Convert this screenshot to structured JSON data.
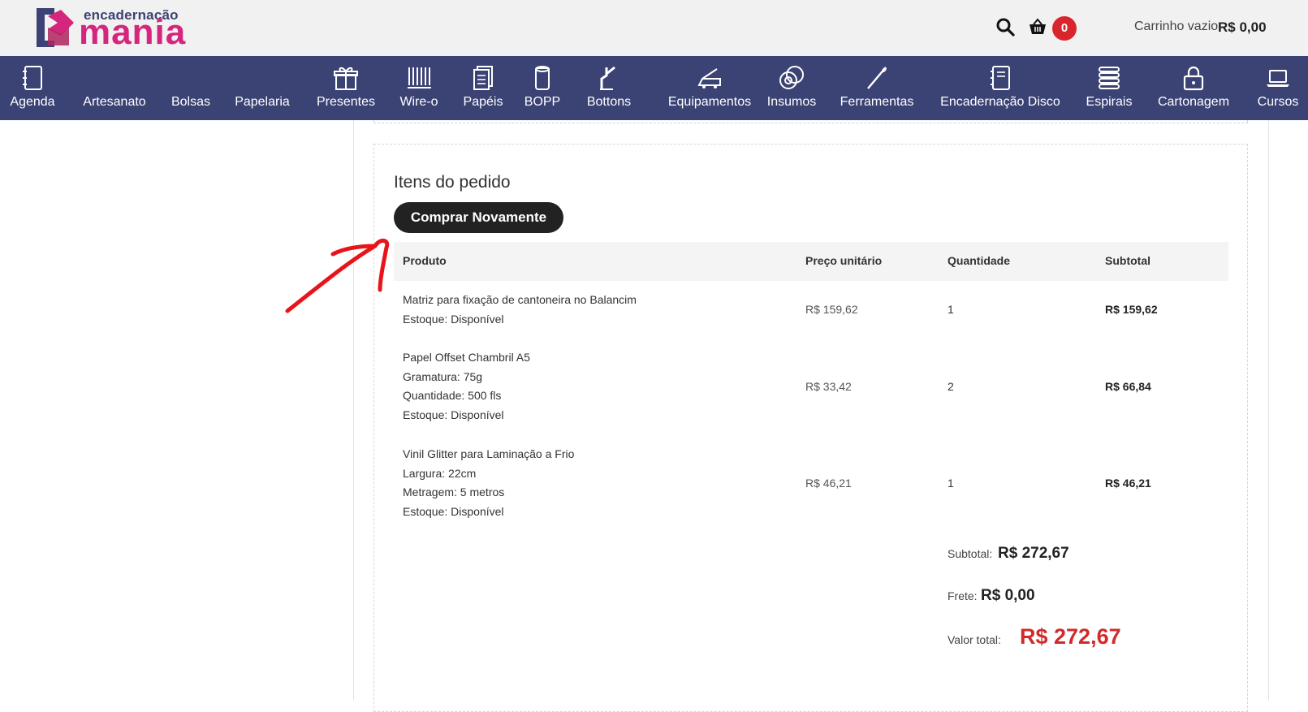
{
  "header": {
    "logo_small": "encadernação",
    "logo_big": "mania",
    "cart_count": "0",
    "cart_status": "Carrinho vazio",
    "cart_total": "R$ 0,00"
  },
  "nav": [
    {
      "label": "Agenda",
      "icon": "notebook-icon"
    },
    {
      "label": "Artesanato",
      "icon": "craft-icon"
    },
    {
      "label": "Bolsas",
      "icon": "bag-icon"
    },
    {
      "label": "Papelaria",
      "icon": "stationery-icon"
    },
    {
      "label": "Presentes",
      "icon": "gift-icon"
    },
    {
      "label": "Wire-o",
      "icon": "wire-o-icon"
    },
    {
      "label": "Papéis",
      "icon": "papers-icon"
    },
    {
      "label": "BOPP",
      "icon": "bopp-roll-icon"
    },
    {
      "label": "Bottons",
      "icon": "button-press-icon"
    },
    {
      "label": "Equipamentos",
      "icon": "laminator-icon"
    },
    {
      "label": "Insumos",
      "icon": "tape-rolls-icon"
    },
    {
      "label": "Ferramentas",
      "icon": "needle-icon"
    },
    {
      "label": "Encadernação Disco",
      "icon": "disc-binding-icon"
    },
    {
      "label": "Espirais",
      "icon": "spiral-icon"
    },
    {
      "label": "Cartonagem",
      "icon": "lock-box-icon"
    },
    {
      "label": "Cursos",
      "icon": "laptop-icon"
    }
  ],
  "order": {
    "title": "Itens do pedido",
    "buy_again": "Comprar Novamente",
    "columns": [
      "Produto",
      "Preço unitário",
      "Quantidade",
      "Subtotal"
    ],
    "items": [
      {
        "lines": [
          "Matriz para fixação de cantoneira no Balancim",
          "Estoque: Disponível"
        ],
        "price": "R$ 159,62",
        "qty": "1",
        "subtotal": "R$ 159,62"
      },
      {
        "lines": [
          "Papel Offset Chambril A5",
          "Gramatura: 75g",
          "Quantidade: 500 fls",
          "Estoque: Disponível"
        ],
        "price": "R$ 33,42",
        "qty": "2",
        "subtotal": "R$ 66,84"
      },
      {
        "lines": [
          "Vinil Glitter para Laminação a Frio",
          "Largura: 22cm",
          "Metragem: 5 metros",
          "Estoque: Disponível"
        ],
        "price": "R$ 46,21",
        "qty": "1",
        "subtotal": "R$ 46,21"
      }
    ],
    "totals": {
      "subtotal_label": "Subtotal:",
      "subtotal_value": "R$ 272,67",
      "frete_label": "Frete:",
      "frete_value": "R$ 0,00",
      "total_label": "Valor total:",
      "total_value": "R$ 272,67"
    }
  },
  "colors": {
    "nav_bg": "#3b4274",
    "brand_pink": "#d4267f",
    "badge_red": "#d9262c",
    "total_red": "#d02b2b",
    "annotation_red": "#e8141a"
  }
}
